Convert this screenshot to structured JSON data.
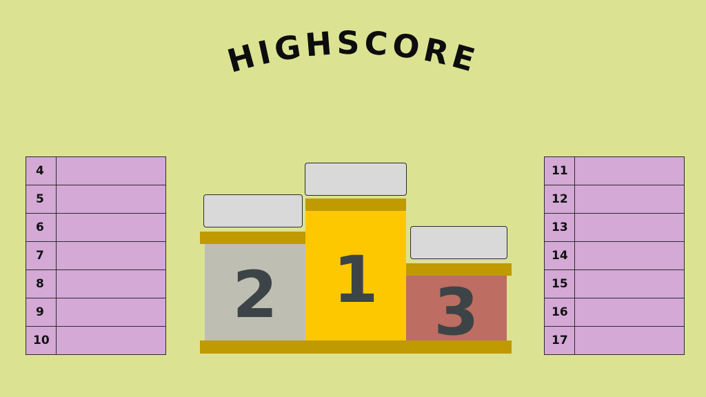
{
  "title": "HIGHSCORE",
  "colors": {
    "background": "#dbe393",
    "first": "#fec800",
    "second": "#bebeb2",
    "third": "#bd6d61",
    "gold_trim": "#bf9a00",
    "table_cell": "#d4a9d6",
    "name_box": "#d9d9d9"
  },
  "podium": {
    "first": {
      "rank": "1",
      "name": ""
    },
    "second": {
      "rank": "2",
      "name": ""
    },
    "third": {
      "rank": "3",
      "name": ""
    }
  },
  "left_table": [
    {
      "rank": "4",
      "name": ""
    },
    {
      "rank": "5",
      "name": ""
    },
    {
      "rank": "6",
      "name": ""
    },
    {
      "rank": "7",
      "name": ""
    },
    {
      "rank": "8",
      "name": ""
    },
    {
      "rank": "9",
      "name": ""
    },
    {
      "rank": "10",
      "name": ""
    }
  ],
  "right_table": [
    {
      "rank": "11",
      "name": ""
    },
    {
      "rank": "12",
      "name": ""
    },
    {
      "rank": "13",
      "name": ""
    },
    {
      "rank": "14",
      "name": ""
    },
    {
      "rank": "15",
      "name": ""
    },
    {
      "rank": "16",
      "name": ""
    },
    {
      "rank": "17",
      "name": ""
    }
  ]
}
